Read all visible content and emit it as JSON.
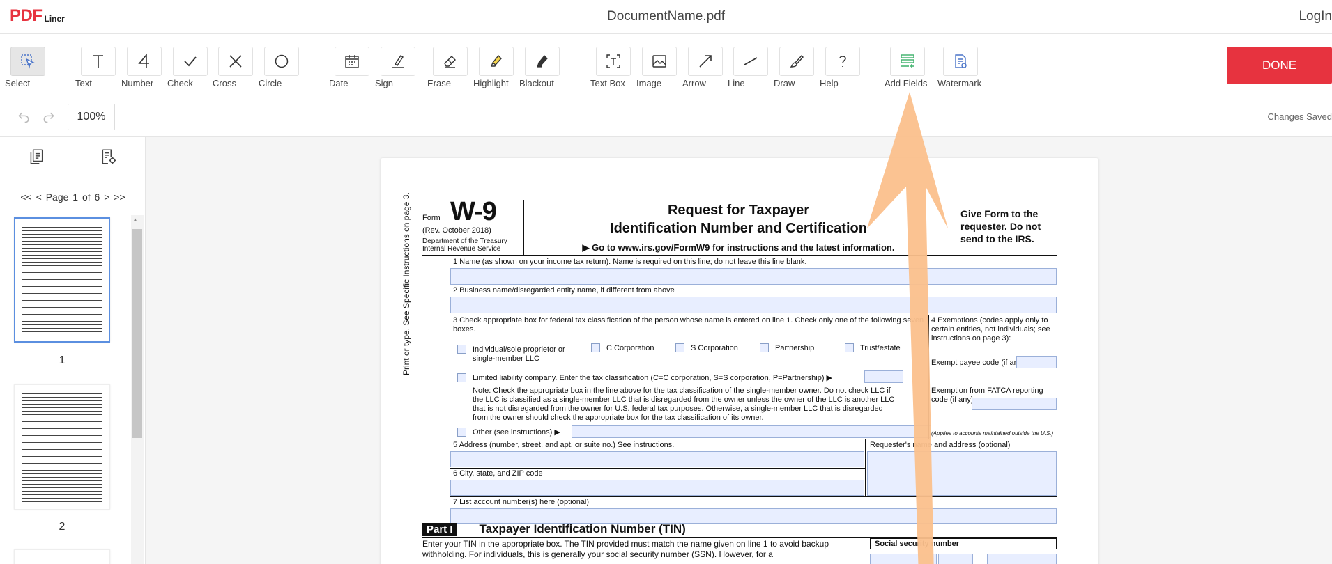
{
  "app": {
    "logo_mark": "PDF",
    "logo_sub": "Liner",
    "document_name": "DocumentName.pdf",
    "login_label": "LogIn"
  },
  "toolbar": {
    "tools": [
      {
        "label": "Select",
        "icon": "select-cursor-icon"
      },
      {
        "label": "Text",
        "icon": "text-t-icon"
      },
      {
        "label": "Number",
        "icon": "number-4-icon"
      },
      {
        "label": "Check",
        "icon": "checkmark-icon"
      },
      {
        "label": "Cross",
        "icon": "cross-x-icon"
      },
      {
        "label": "Circle",
        "icon": "circle-icon"
      },
      {
        "label": "Date",
        "icon": "calendar-icon"
      },
      {
        "label": "Sign",
        "icon": "pen-sign-icon"
      },
      {
        "label": "Erase",
        "icon": "eraser-icon"
      },
      {
        "label": "Highlight",
        "icon": "highlighter-icon"
      },
      {
        "label": "Blackout",
        "icon": "blackout-marker-icon"
      },
      {
        "label": "Text Box",
        "icon": "text-box-icon"
      },
      {
        "label": "Image",
        "icon": "image-icon"
      },
      {
        "label": "Arrow",
        "icon": "arrow-icon"
      },
      {
        "label": "Line",
        "icon": "line-icon"
      },
      {
        "label": "Draw",
        "icon": "brush-draw-icon"
      },
      {
        "label": "Help",
        "icon": "question-icon"
      },
      {
        "label": "Add Fields",
        "icon": "add-fields-icon"
      },
      {
        "label": "Watermark",
        "icon": "watermark-icon"
      }
    ],
    "done_label": "DONE"
  },
  "subbar": {
    "zoom": "100%",
    "status": "Changes Saved"
  },
  "sidebar": {
    "pager_first": "<<",
    "pager_prev": "< Page 1 of 6 >",
    "pager_next": ">>",
    "thumbnails": [
      {
        "label": "1"
      },
      {
        "label": "2"
      }
    ]
  },
  "form": {
    "form_word": "Form",
    "number": "W-9",
    "revision": "(Rev. October 2018)",
    "department": "Department of the Treasury Internal Revenue Service",
    "title_line1": "Request for Taxpayer",
    "title_line2": "Identification Number and Certification",
    "goto": "▶ Go to www.irs.gov/FormW9 for instructions and the latest information.",
    "give_form": "Give Form to the requester. Do not send to the IRS.",
    "vertical_label": "Print or type.   See Specific Instructions on page 3.",
    "line1": "1  Name (as shown on your income tax return). Name is required on this line; do not leave this line blank.",
    "line2": "2  Business name/disregarded entity name, if different from above",
    "line3": "3  Check appropriate box for federal tax classification of the person whose name is entered on line 1. Check only one of the following seven boxes.",
    "exemptions": "4 Exemptions (codes apply only to certain entities, not individuals; see instructions on page 3):",
    "individual": "Individual/sole proprietor or single-member LLC",
    "c_corp": "C Corporation",
    "s_corp": "S Corporation",
    "partnership": "Partnership",
    "trust": "Trust/estate",
    "exempt_payee": "Exempt payee code (if any)",
    "llc": "Limited liability company. Enter the tax classification (C=C corporation, S=S corporation, P=Partnership) ▶",
    "note": "Note: Check the appropriate box in the line above for the tax classification of the single-member owner.  Do not check LLC if the LLC is classified as a single-member LLC that is disregarded from the owner unless the owner of the LLC is another LLC that is not disregarded from the owner for U.S. federal tax purposes. Otherwise, a single-member LLC that is disregarded from the owner should check the appropriate box for the tax classification of its owner.",
    "fatca": "Exemption from FATCA reporting code (if any)",
    "fatca_note": "(Applies to accounts maintained outside the U.S.)",
    "other": "Other (see instructions) ▶",
    "line5": "5  Address (number, street, and apt. or suite no.) See instructions.",
    "requester": "Requester's name and address (optional)",
    "line6": "6  City, state, and ZIP code",
    "line7": "7  List account number(s) here (optional)",
    "part_tag": "Part I",
    "part_title": "Taxpayer Identification Number (TIN)",
    "tin_text": "Enter your TIN in the appropriate box. The TIN provided must match the name given on line 1 to avoid backup withholding. For individuals, this is generally your social security number (SSN). However, for a",
    "ssn": "Social security number"
  },
  "colors": {
    "accent": "#e7333f",
    "field_fill": "#e8eeff",
    "arrow": "#fbc08c",
    "add_fields_green": "#3cb06a",
    "watermark_blue": "#4a74c9"
  }
}
